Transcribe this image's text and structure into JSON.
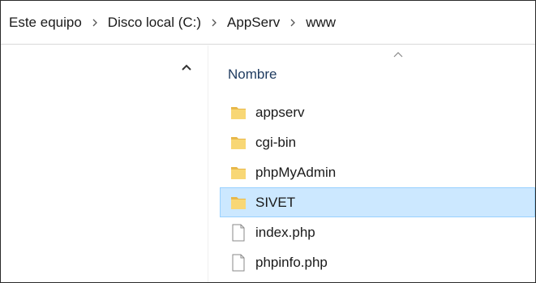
{
  "breadcrumb": {
    "items": [
      {
        "label": "Este equipo"
      },
      {
        "label": "Disco local (C:)"
      },
      {
        "label": "AppServ"
      },
      {
        "label": "www"
      }
    ]
  },
  "file_list": {
    "column_header": "Nombre",
    "sort_direction": "ascending",
    "files": [
      {
        "name": "appserv",
        "type": "folder",
        "selected": false
      },
      {
        "name": "cgi-bin",
        "type": "folder",
        "selected": false
      },
      {
        "name": "phpMyAdmin",
        "type": "folder",
        "selected": false
      },
      {
        "name": "SIVET",
        "type": "folder",
        "selected": true
      },
      {
        "name": "index.php",
        "type": "file",
        "selected": false
      },
      {
        "name": "phpinfo.php",
        "type": "file",
        "selected": false
      }
    ]
  },
  "icons": {
    "folder": "folder-icon",
    "file": "file-icon",
    "separator": "chevron-right-icon",
    "nav_scroll": "chevron-up-icon",
    "sort": "sort-ascending-icon"
  },
  "colors": {
    "selection_fill": "#cce8ff",
    "selection_border": "#99d1ff",
    "folder": "#f8d775",
    "folder_dark": "#e8b84a",
    "header_text": "#1e3a5f"
  }
}
